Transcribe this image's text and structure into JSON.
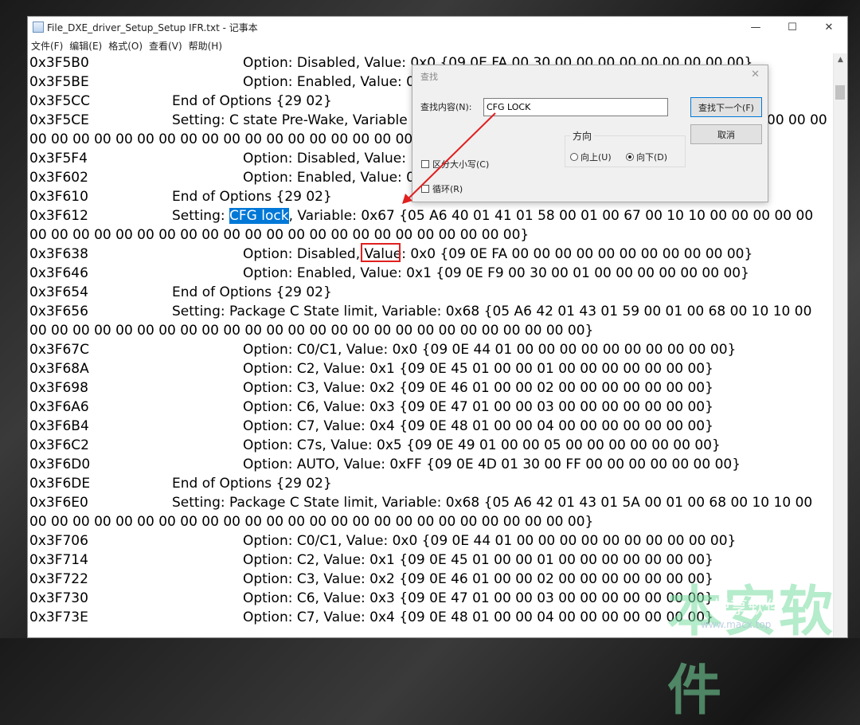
{
  "window": {
    "title": "File_DXE_driver_Setup_Setup IFR.txt - 记事本",
    "minimize": "—",
    "maximize": "☐",
    "close": "✕"
  },
  "menu": [
    "文件(F)",
    "编辑(E)",
    "格式(O)",
    "查看(V)",
    "帮助(H)"
  ],
  "lines": [
    {
      "addr": "0x3F5B0",
      "indent": 2,
      "text": "Option: Disabled, Value: 0x0 {09 0E FA 00 30 00 00 00 00 00 00 00 00 00}"
    },
    {
      "addr": "0x3F5BE",
      "indent": 2,
      "text": "Option: Enabled, Value: 0"
    },
    {
      "addr": "0x3F5CC",
      "indent": 1,
      "text": "End of Options {29 02}"
    },
    {
      "addr": "0x3F5CE",
      "indent": 1,
      "text": "Setting: C state Pre-Wake, Variable"
    },
    {
      "addr": "",
      "indent": 0,
      "text": "00 00 00 00 00 00 00 00 00 00 00 00 00 00 00 00 00 00 00 00 00"
    },
    {
      "addr": "0x3F5F4",
      "indent": 2,
      "text": "Option: Disabled, Value:"
    },
    {
      "addr": "0x3F602",
      "indent": 2,
      "text": "Option: Enabled, Value: 0"
    },
    {
      "addr": "0x3F610",
      "indent": 1,
      "text": "End of Options {29 02}"
    },
    {
      "addr": "0x3F612",
      "indent": 1,
      "text": "Setting: CFG lock, Variable: 0x67 {05 A6 40 01 41 01 58 00 01 00 67 00 10 10 00 00 00 00 00"
    },
    {
      "addr": "",
      "indent": 0,
      "text": "00 00 00 00 00 00 00 00 00 00 00 00 00 00 00 00 00 00 00 00 00 00 00}"
    },
    {
      "addr": "0x3F638",
      "indent": 2,
      "text": "Option: Disabled, Value: 0x0 {09 0E FA 00 00 00 00 00 00 00 00 00 00 00}"
    },
    {
      "addr": "0x3F646",
      "indent": 2,
      "text": "Option: Enabled, Value: 0x1 {09 0E F9 00 30 00 01 00 00 00 00 00 00 00}"
    },
    {
      "addr": "0x3F654",
      "indent": 1,
      "text": "End of Options {29 02}"
    },
    {
      "addr": "0x3F656",
      "indent": 1,
      "text": "Setting: Package C State limit, Variable: 0x68 {05 A6 42 01 43 01 59 00 01 00 68 00 10 10 00"
    },
    {
      "addr": "",
      "indent": 0,
      "text": "00 00 00 00 00 00 00 00 00 00 00 00 00 00 00 00 00 00 00 00 00 00 00 00 00 00}"
    },
    {
      "addr": "0x3F67C",
      "indent": 2,
      "text": "Option: C0/C1, Value: 0x0 {09 0E 44 01 00 00 00 00 00 00 00 00 00 00}"
    },
    {
      "addr": "0x3F68A",
      "indent": 2,
      "text": "Option: C2, Value: 0x1 {09 0E 45 01 00 00 01 00 00 00 00 00 00 00}"
    },
    {
      "addr": "0x3F698",
      "indent": 2,
      "text": "Option: C3, Value: 0x2 {09 0E 46 01 00 00 02 00 00 00 00 00 00 00}"
    },
    {
      "addr": "0x3F6A6",
      "indent": 2,
      "text": "Option: C6, Value: 0x3 {09 0E 47 01 00 00 03 00 00 00 00 00 00 00}"
    },
    {
      "addr": "0x3F6B4",
      "indent": 2,
      "text": "Option: C7, Value: 0x4 {09 0E 48 01 00 00 04 00 00 00 00 00 00 00}"
    },
    {
      "addr": "0x3F6C2",
      "indent": 2,
      "text": "Option: C7s, Value: 0x5 {09 0E 49 01 00 00 05 00 00 00 00 00 00 00}"
    },
    {
      "addr": "0x3F6D0",
      "indent": 2,
      "text": "Option: AUTO, Value: 0xFF {09 0E 4D 01 30 00 FF 00 00 00 00 00 00 00}"
    },
    {
      "addr": "0x3F6DE",
      "indent": 1,
      "text": "End of Options {29 02}"
    },
    {
      "addr": "0x3F6E0",
      "indent": 1,
      "text": "Setting: Package C State limit, Variable: 0x68 {05 A6 42 01 43 01 5A 00 01 00 68 00 10 10 00"
    },
    {
      "addr": "",
      "indent": 0,
      "text": "00 00 00 00 00 00 00 00 00 00 00 00 00 00 00 00 00 00 00 00 00 00 00 00 00 00}"
    },
    {
      "addr": "0x3F706",
      "indent": 2,
      "text": "Option: C0/C1, Value: 0x0 {09 0E 44 01 00 00 00 00 00 00 00 00 00 00}"
    },
    {
      "addr": "0x3F714",
      "indent": 2,
      "text": "Option: C2, Value: 0x1 {09 0E 45 01 00 00 01 00 00 00 00 00 00 00}"
    },
    {
      "addr": "0x3F722",
      "indent": 2,
      "text": "Option: C3, Value: 0x2 {09 0E 46 01 00 00 02 00 00 00 00 00 00 00}"
    },
    {
      "addr": "0x3F730",
      "indent": 2,
      "text": "Option: C6, Value: 0x3 {09 0E 47 01 00 00 03 00 00 00 00 00 00 00}"
    },
    {
      "addr": "0x3F73E",
      "indent": 2,
      "text": "Option: C7, Value: 0x4 {09 0E 48 01 00 00 04 00 00 00 00 00 00 00}"
    }
  ],
  "line_3f5ce_tail": "00 00 00",
  "selection": "CFG lock",
  "highlighted_value": "0x67",
  "find_dialog": {
    "title": "查找",
    "find_label": "查找内容(N):",
    "find_value": "CFG LOCK",
    "find_next": "查找下一个(F)",
    "cancel": "取消",
    "direction_label": "方向",
    "up": "向上(U)",
    "down": "向下(D)",
    "direction_selected": "down",
    "match_case": "区分大小写(C)",
    "wrap": "循环(R)"
  },
  "watermark": {
    "big": "本安软件",
    "small": "悦享软件",
    "url": "www.macx.top"
  },
  "colors": {
    "selection": "#0078d7",
    "annotation": "#e02020"
  }
}
